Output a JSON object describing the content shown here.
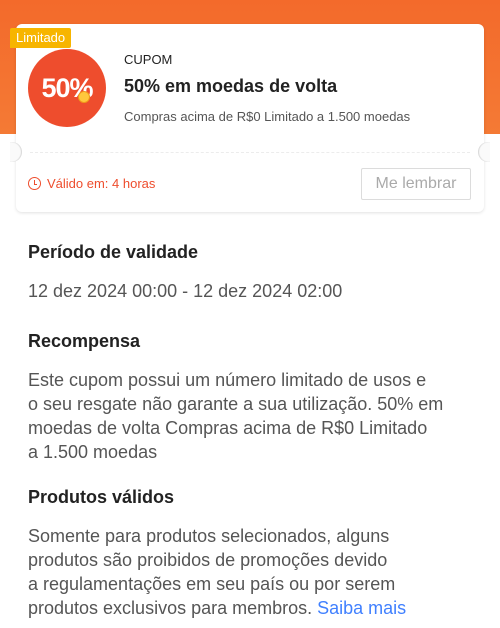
{
  "coupon": {
    "badge": "Limitado",
    "percent_label": "50%",
    "type": "CUPOM",
    "title": "50% em moedas de volta",
    "subtitle": "Compras acima de R$0 Limitado a 1.500 moedas",
    "validity": "Válido em: 4 horas",
    "remind_label": "Me lembrar"
  },
  "validity_section": {
    "title": "Período de validade",
    "value": "12 dez 2024 00:00 - 12 dez 2024 02:00"
  },
  "reward_section": {
    "title": "Recompensa",
    "lines": [
      "Este cupom possui um número limitado de usos e",
      "o seu resgate não garante a sua utilização. 50% em",
      "moedas de volta Compras acima de R$0 Limitado",
      "a 1.500 moedas"
    ]
  },
  "products_section": {
    "title": "Produtos válidos",
    "lines": [
      "Somente para produtos selecionados, alguns",
      "produtos são proibidos de promoções devido",
      "a regulamentações em seu país ou por serem"
    ],
    "last_line": "produtos exclusivos para membros.",
    "link_label": "Saiba mais"
  },
  "colors": {
    "accent": "#ee4d2d",
    "banner": "#f36a2b",
    "badge": "#f7b500",
    "link": "#4080ff"
  }
}
